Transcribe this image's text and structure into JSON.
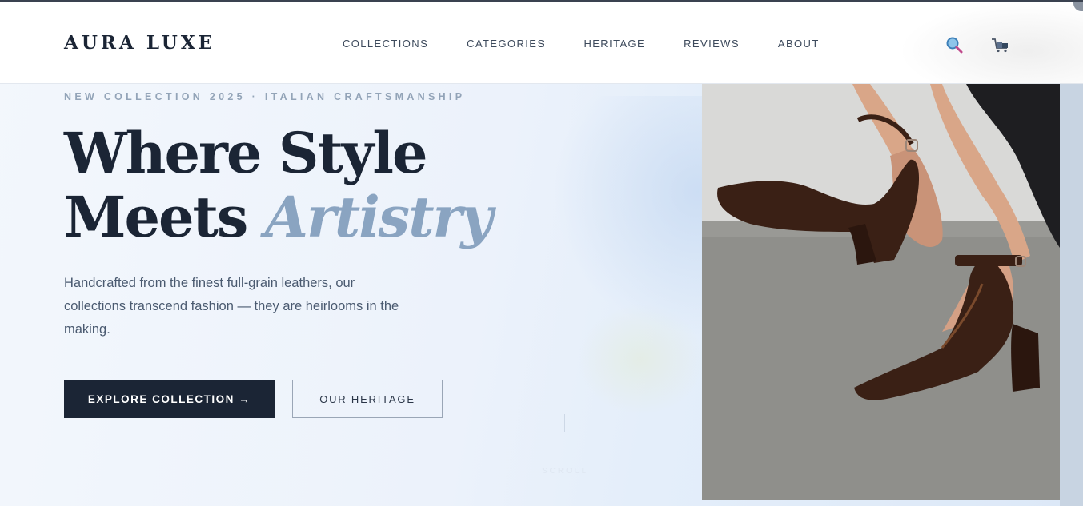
{
  "brand": {
    "logo": "AURA LUXE"
  },
  "nav": {
    "items": [
      {
        "label": "COLLECTIONS"
      },
      {
        "label": "CATEGORIES"
      },
      {
        "label": "HERITAGE"
      },
      {
        "label": "REVIEWS"
      },
      {
        "label": "ABOUT"
      }
    ]
  },
  "header_icons": {
    "search": "search-icon",
    "cart": "shopping-bag-icon"
  },
  "hero": {
    "eyebrow": "NEW COLLECTION 2025  ·  ITALIAN CRAFTSMANSHIP",
    "title_line1": "Where Style",
    "title_line2_plain": "Meets ",
    "title_line2_accent": "Artistry",
    "description": "Handcrafted from the finest full-grain leathers, our collections transcend fashion — they are heirlooms in the making.",
    "primary_button": "EXPLORE COLLECTION →",
    "secondary_button": "OUR HERITAGE",
    "scroll_label": "SCROLL"
  },
  "colors": {
    "brand_dark": "#1b2535",
    "accent": "#8aa4c1",
    "shoe": "#3a2015"
  }
}
